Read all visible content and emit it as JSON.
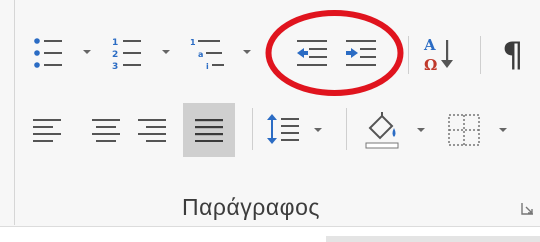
{
  "group": {
    "label": "Παράγραφος"
  },
  "controls": {
    "bullets": "bullets-icon",
    "numbering": "numbering-icon",
    "multilevel": "multilevel-list-icon",
    "decrease_indent": "decrease-indent-icon",
    "increase_indent": "increase-indent-icon",
    "sort": "sort-icon",
    "show_marks": "pilcrow-icon",
    "show_marks_glyph": "¶",
    "align_left": "align-left-icon",
    "center": "align-center-icon",
    "align_right": "align-right-icon",
    "justify": "justify-icon",
    "line_spacing": "line-spacing-icon",
    "shading": "shading-icon",
    "borders": "borders-icon",
    "sort_letters": [
      "A",
      "Ω"
    ]
  },
  "state": {
    "justify_selected": true
  },
  "annotation": {
    "color": "#e0141e",
    "shape": "ellipse"
  },
  "colors": {
    "accent_blue": "#2b6cc4",
    "icon_gray": "#555555"
  }
}
